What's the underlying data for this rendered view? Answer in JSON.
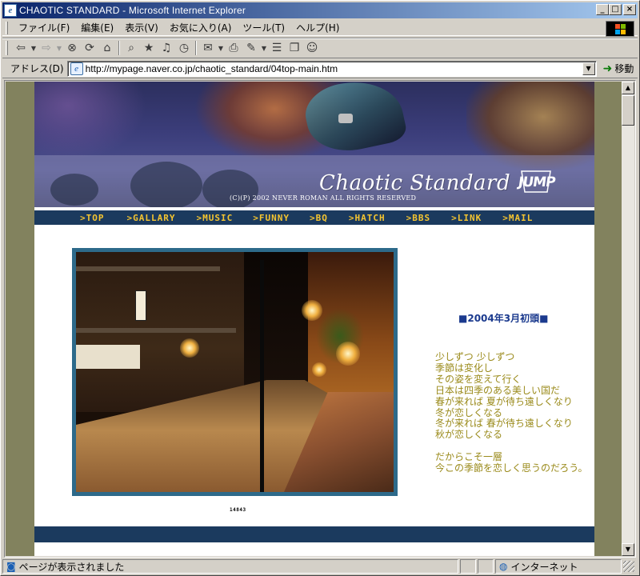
{
  "window": {
    "title": "CHAOTIC STANDARD - Microsoft Internet Explorer",
    "minimize": "_",
    "maximize": "□",
    "close": "×"
  },
  "menu": [
    "ファイル(F)",
    "編集(E)",
    "表示(V)",
    "お気に入り(A)",
    "ツール(T)",
    "ヘルプ(H)"
  ],
  "toolbar": {
    "back_icon": "back-arrow-icon",
    "forward_icon": "forward-arrow-icon",
    "stop_icon": "stop-icon",
    "refresh_icon": "refresh-icon",
    "home_icon": "home-icon",
    "search_icon": "search-icon",
    "favorites_icon": "favorites-icon",
    "history_icon": "history-icon",
    "media_icon": "media-icon",
    "mail_icon": "mail-icon",
    "print_icon": "print-icon",
    "edit_icon": "edit-icon",
    "discuss_icon": "discuss-icon",
    "messenger_icon": "messenger-icon"
  },
  "address": {
    "label": "アドレス(D)",
    "url": "http://mypage.naver.co.jp/chaotic_standard/04top-main.htm",
    "go_label": "移動"
  },
  "site": {
    "logo": "Chaotic Standard",
    "badge": "JUMP",
    "copyright": "(C)(P) 2002 NEVER ROMAN ALL RIGHTS RESERVED",
    "nav": [
      ">TOP",
      ">GALLARY",
      ">MUSIC",
      ">FUNNY",
      ">BQ",
      ">HATCH",
      ">BBS",
      ">LINK",
      ">MAIL"
    ],
    "date_heading": "■2004年3月初頭■",
    "poem": [
      "少しずつ 少しずつ",
      "季節は変化し",
      "その姿を変えて行く",
      "日本は四季のある美しい国だ",
      "春が来れば 夏が待ち遠しくなり",
      "冬が恋しくなる",
      "冬が来れば 春が待ち遠しくなり",
      "秋が恋しくなる",
      "",
      "だからこそ一層",
      "今この季節を恋しく思うのだろう。"
    ],
    "counter": "14843"
  },
  "status": {
    "message": "ページが表示されました",
    "zone": "インターネット"
  },
  "colors": {
    "page_bg": "#82825e",
    "nav_bg": "#1b3a5e",
    "nav_text": "#f4c430",
    "poem_text": "#9a8a1a",
    "heading_text": "#1b3a8e",
    "photo_border": "#2d6a8a"
  }
}
